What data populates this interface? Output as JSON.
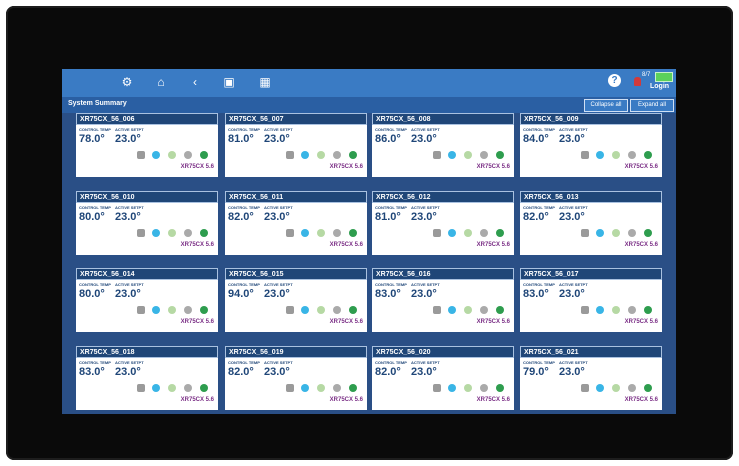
{
  "header": {
    "icons": [
      "gear-icon",
      "home-icon",
      "back-icon",
      "box-icon",
      "calendar-icon"
    ],
    "help": "?",
    "alarm_count": "8/7",
    "login": "Login"
  },
  "summary": {
    "title": "System Summary",
    "collapse": "Collapse all",
    "expand": "Expand all"
  },
  "labels": {
    "control_temp": "CONTROL TEMP",
    "active_setpt": "ACTIVE SETPT"
  },
  "units": [
    {
      "name": "XR75CX_56_006",
      "control": "78.0°",
      "setpt": "23.0°",
      "model": "XR75CX 5.6"
    },
    {
      "name": "XR75CX_56_007",
      "control": "81.0°",
      "setpt": "23.0°",
      "model": "XR75CX 5.6"
    },
    {
      "name": "XR75CX_56_008",
      "control": "86.0°",
      "setpt": "23.0°",
      "model": "XR75CX 5.6"
    },
    {
      "name": "XR75CX_56_009",
      "control": "84.0°",
      "setpt": "23.0°",
      "model": "XR75CX 5.6"
    },
    {
      "name": "XR75CX_56_010",
      "control": "80.0°",
      "setpt": "23.0°",
      "model": "XR75CX 5.6"
    },
    {
      "name": "XR75CX_56_011",
      "control": "82.0°",
      "setpt": "23.0°",
      "model": "XR75CX 5.6"
    },
    {
      "name": "XR75CX_56_012",
      "control": "81.0°",
      "setpt": "23.0°",
      "model": "XR75CX 5.6"
    },
    {
      "name": "XR75CX_56_013",
      "control": "82.0°",
      "setpt": "23.0°",
      "model": "XR75CX 5.6"
    },
    {
      "name": "XR75CX_56_014",
      "control": "80.0°",
      "setpt": "23.0°",
      "model": "XR75CX 5.6"
    },
    {
      "name": "XR75CX_56_015",
      "control": "94.0°",
      "setpt": "23.0°",
      "model": "XR75CX 5.6"
    },
    {
      "name": "XR75CX_56_016",
      "control": "83.0°",
      "setpt": "23.0°",
      "model": "XR75CX 5.6"
    },
    {
      "name": "XR75CX_56_017",
      "control": "83.0°",
      "setpt": "23.0°",
      "model": "XR75CX 5.6"
    },
    {
      "name": "XR75CX_56_018",
      "control": "83.0°",
      "setpt": "23.0°",
      "model": "XR75CX 5.6"
    },
    {
      "name": "XR75CX_56_019",
      "control": "82.0°",
      "setpt": "23.0°",
      "model": "XR75CX 5.6"
    },
    {
      "name": "XR75CX_56_020",
      "control": "82.0°",
      "setpt": "23.0°",
      "model": "XR75CX 5.6"
    },
    {
      "name": "XR75CX_56_021",
      "control": "79.0°",
      "setpt": "23.0°",
      "model": "XR75CX 5.6"
    }
  ]
}
